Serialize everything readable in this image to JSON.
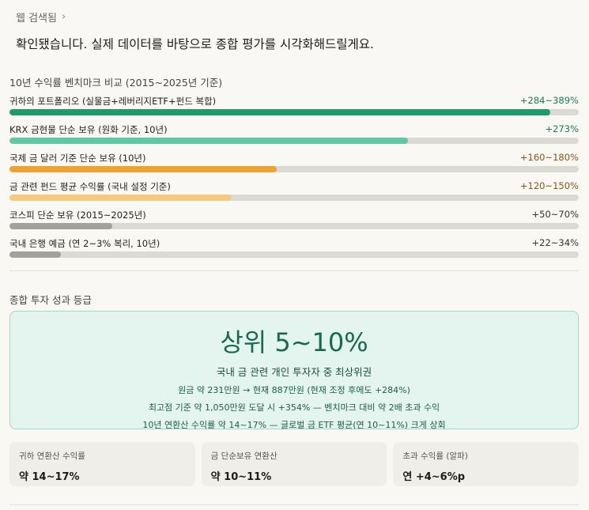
{
  "header": {
    "search_link": "웹 검색됨"
  },
  "intro_text": "확인됐습니다. 실제 데이터를 바탕으로 종합 평가를 시각화해드릴게요.",
  "benchmark_title": "10년 수익률 벤치마크 비교 (2015~2025년 기준)",
  "chart_data": {
    "type": "bar",
    "orientation": "horizontal",
    "title": "10년 수익률 벤치마크 비교 (2015~2025년 기준)",
    "xlim": [
      0,
      400
    ],
    "items": [
      {
        "label": "귀하의 포트폴리오 (실물금+레버리지ETF+펀드 복합)",
        "value_text": "+284~389%",
        "fill": 0.95,
        "color": "#1f9a6e",
        "text_color": "#1a7d59"
      },
      {
        "label": "KRX 금현물 단순 보유 (원화 기준, 10년)",
        "value_text": "+273%",
        "fill": 0.7,
        "color": "#5fc8a4",
        "text_color": "#1a7d59"
      },
      {
        "label": "국제 금 달러 기준 단순 보유 (10년)",
        "value_text": "+160~180%",
        "fill": 0.47,
        "color": "#eea230",
        "text_color": "#8a5410"
      },
      {
        "label": "금 관련 펀드 평균 수익률 (국내 설정 기준)",
        "value_text": "+120~150%",
        "fill": 0.39,
        "color": "#f6c97c",
        "text_color": "#8a5410"
      },
      {
        "label": "코스피 단순 보유 (2015~2025년)",
        "value_text": "+50~70%",
        "fill": 0.18,
        "color": "#a3a19b",
        "text_color": "#333333"
      },
      {
        "label": "국내 은행 예금 (연 2~3% 복리, 10년)",
        "value_text": "+22~34%",
        "fill": 0.09,
        "color": "#a3a19b",
        "text_color": "#333333"
      }
    ]
  },
  "grade_section": {
    "title": "종합 투자 성과 등급",
    "grade": "상위 5~10%",
    "subtitle": "국내 금 관련 개인 투자자 중 최상위권",
    "lines": [
      "원금 약 231만원 → 현재 887만원 (현재 조정 후에도 +284%)",
      "최고점 기준 약 1,050만원 도달 시 +354% — 벤치마크 대비 약 2배 초과 수익",
      "10년 연환산 수익률 약 14~17% — 글로벌 금 ETF 평균(연 10~11%) 크게 상회"
    ]
  },
  "cards": [
    {
      "label": "귀하 연환산 수익률",
      "value": "약 14~17%"
    },
    {
      "label": "금 단순보유 연환산",
      "value": "약 10~11%"
    },
    {
      "label": "초과 수익률 (알파)",
      "value": "연 +4~6%p"
    }
  ]
}
